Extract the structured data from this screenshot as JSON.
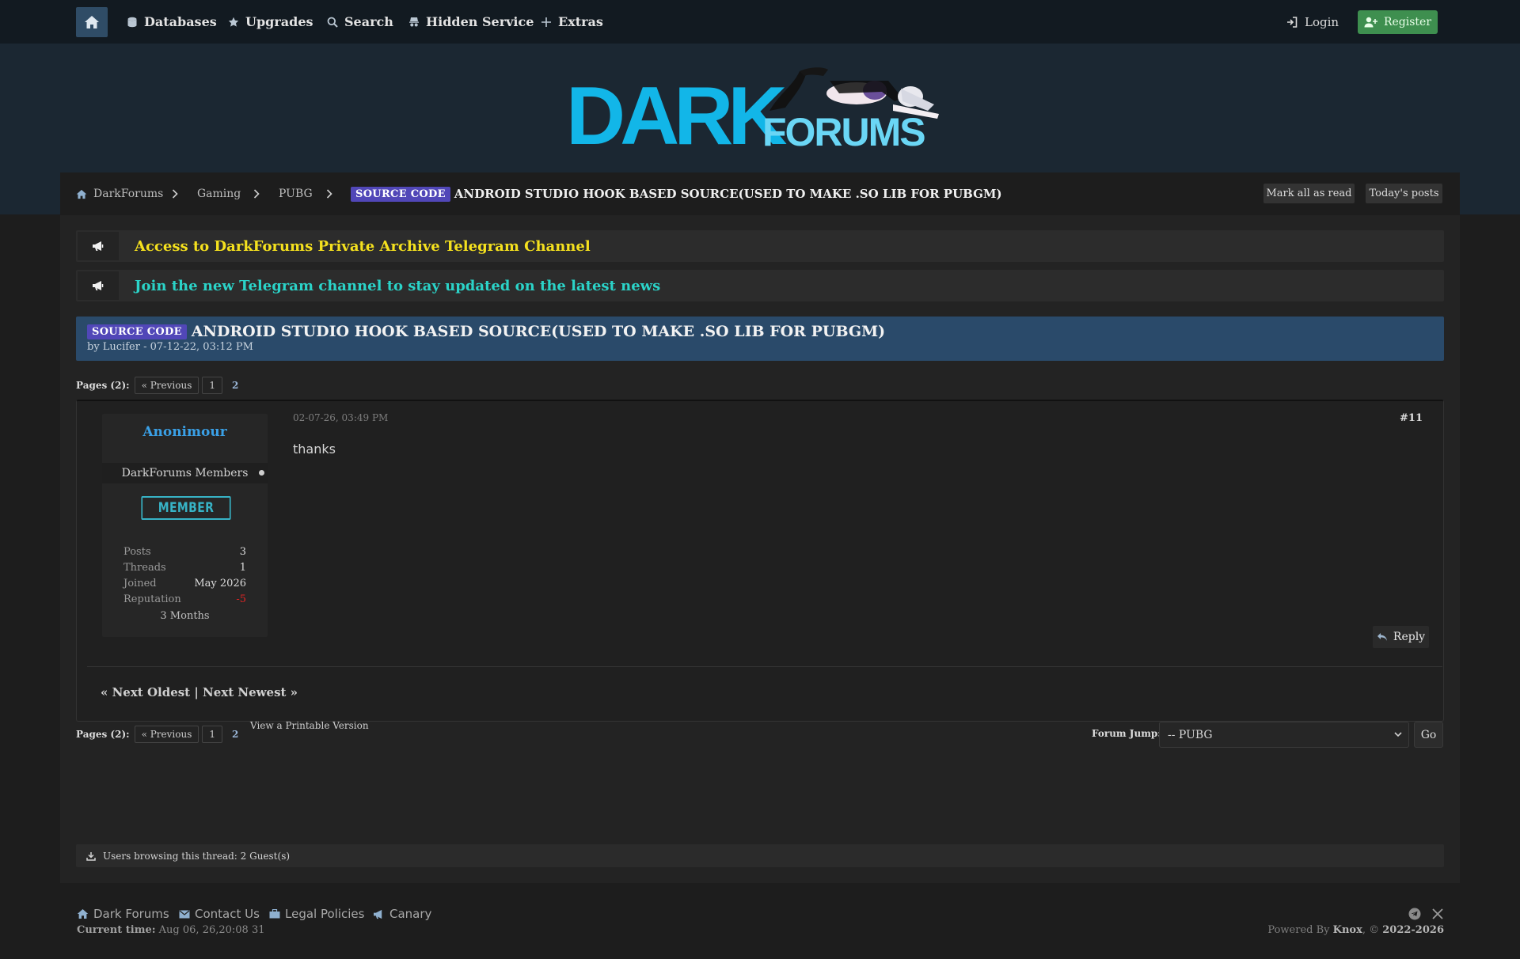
{
  "nav": {
    "items": [
      {
        "label": "Databases",
        "icon": "database-icon"
      },
      {
        "label": "Upgrades",
        "icon": "star-icon"
      },
      {
        "label": "Search",
        "icon": "search-icon"
      },
      {
        "label": "Hidden Service",
        "icon": "incognito-icon"
      },
      {
        "label": "Extras",
        "icon": "plus-icon"
      }
    ],
    "login_label": "Login",
    "register_label": "Register"
  },
  "logo": {
    "word1": "DARK",
    "word2": "FORUMS"
  },
  "breadcrumb": {
    "items": [
      "DarkForums",
      "Gaming",
      "PUBG"
    ],
    "prefix": "SOURCE CODE",
    "current": "ANDROID STUDIO HOOK BASED SOURCE(USED TO MAKE .SO LIB FOR PUBGM)"
  },
  "toolbar": {
    "mark_read": "Mark all as read",
    "todays_posts": "Today's posts"
  },
  "announcements": [
    {
      "text": "Access to DarkForums Private Archive Telegram Channel",
      "color": "#f5e11e"
    },
    {
      "text": "Join the new Telegram channel to stay updated on the latest news",
      "color": "#2bd3c8"
    }
  ],
  "thread": {
    "prefix": "SOURCE CODE",
    "title": "ANDROID STUDIO HOOK BASED SOURCE(USED TO MAKE .SO LIB FOR PUBGM)",
    "byline": "by Lucifer - 07-12-22, 03:12 PM"
  },
  "pagination": {
    "label": "Pages (2):",
    "prev": "« Previous",
    "page1": "1",
    "page2": "2"
  },
  "post": {
    "author": "Anonimour",
    "group": "DarkForums Members",
    "rank": "MEMBER",
    "stats": [
      {
        "k": "Posts",
        "v": "3"
      },
      {
        "k": "Threads",
        "v": "1"
      },
      {
        "k": "Joined",
        "v": "May 2026"
      },
      {
        "k": "Reputation",
        "v": "-5"
      }
    ],
    "months": "3 Months",
    "date": "02-07-26, 03:49 PM",
    "number": "#11",
    "body": "thanks",
    "reply_label": "Reply"
  },
  "thread_nav": "« Next Oldest | Next Newest »",
  "printable": "View a Printable Version",
  "forum_jump": {
    "label": "Forum Jump:",
    "selected": "-- PUBG",
    "go": "Go"
  },
  "browsing": "Users browsing this thread: 2 Guest(s)",
  "footer": {
    "links": [
      {
        "label": "Dark Forums",
        "icon": "home-icon"
      },
      {
        "label": "Contact Us",
        "icon": "envelope-icon"
      },
      {
        "label": "Legal Policies",
        "icon": "briefcase-icon"
      },
      {
        "label": "Canary",
        "icon": "megaphone-icon"
      }
    ],
    "current_time_label": "Current time:",
    "current_time_value": "Aug 06, 26,20:08 31",
    "powered_prefix": "Powered By",
    "powered_brand": "Knox",
    "powered_sep": ", ©",
    "powered_years": "2022-2026"
  },
  "colors": {
    "accent": "#2f4c66",
    "register": "#3e8f4f",
    "thread_box": "#2a4a6a",
    "prefix": "#5147b8",
    "author": "#3aa0e6",
    "rank": "#37b3c6",
    "negative": "#e02424"
  }
}
